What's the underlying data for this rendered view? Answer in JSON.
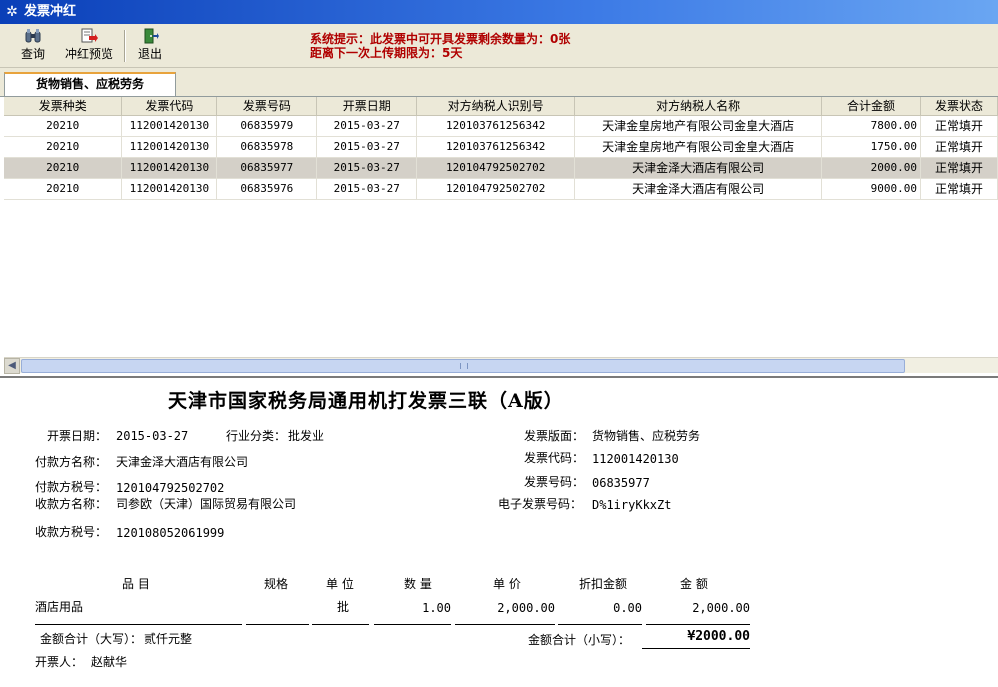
{
  "window": {
    "title": "发票冲红"
  },
  "toolbar": {
    "buttons": [
      {
        "label": "查询",
        "icon": "binoculars-icon"
      },
      {
        "label": "冲红预览",
        "icon": "red-flush-preview-icon"
      },
      {
        "label": "退出",
        "icon": "exit-door-icon"
      }
    ],
    "system_message_line1": "系统提示：此发票中可开具发票剩余数量为：0张",
    "system_message_line2": "距离下一次上传期限为：5天"
  },
  "tabs": [
    {
      "label": "货物销售、应税劳务",
      "active": true
    }
  ],
  "grid": {
    "columns": [
      "发票种类",
      "发票代码",
      "发票号码",
      "开票日期",
      "对方纳税人识别号",
      "对方纳税人名称",
      "合计金额",
      "发票状态"
    ],
    "rows": [
      [
        "20210",
        "112001420130",
        "06835979",
        "2015-03-27",
        "120103761256342",
        "天津金皇房地产有限公司金皇大酒店",
        "7800.00",
        "正常填开"
      ],
      [
        "20210",
        "112001420130",
        "06835978",
        "2015-03-27",
        "120103761256342",
        "天津金皇房地产有限公司金皇大酒店",
        "1750.00",
        "正常填开"
      ],
      [
        "20210",
        "112001420130",
        "06835977",
        "2015-03-27",
        "120104792502702",
        "天津金泽大酒店有限公司",
        "2000.00",
        "正常填开"
      ],
      [
        "20210",
        "112001420130",
        "06835976",
        "2015-03-27",
        "120104792502702",
        "天津金泽大酒店有限公司",
        "9000.00",
        "正常填开"
      ]
    ],
    "selected_row": 2,
    "scrollbar_grip": "|||"
  },
  "invoice": {
    "title": "天津市国家税务局通用机打发票三联（A版）",
    "issue_date_label": "开票日期：",
    "issue_date": "2015-03-27",
    "industry_label": "行业分类：",
    "industry": "批发业",
    "payer_name_label": "付款方名称：",
    "payer_name": "天津金泽大酒店有限公司",
    "payer_tax_label": "付款方税号：",
    "payer_tax": "120104792502702",
    "payee_name_label": "收款方名称：",
    "payee_name": "司参欧（天津）国际贸易有限公司",
    "payee_tax_label": "收款方税号：",
    "payee_tax": "120108052061999",
    "layout_label": "发票版面：",
    "layout": "货物销售、应税劳务",
    "code_label": "发票代码：",
    "code": "112001420130",
    "number_label": "发票号码：",
    "number": "06835977",
    "e_number_label": "电子发票号码：",
    "e_number": "D%1iryKkxZt",
    "items_header": [
      "品 目",
      "规格",
      "单 位",
      "数 量",
      "单 价",
      "折扣金额",
      "金 额"
    ],
    "items": [
      {
        "name": "酒店用品",
        "spec": "",
        "unit": "批",
        "qty": "1.00",
        "price": "2,000.00",
        "discount": "0.00",
        "amount": "2,000.00"
      }
    ],
    "total_upper_label": "金额合计（大写）：",
    "total_upper": "贰仟元整",
    "total_lower_label": "金额合计（小写）：",
    "total_lower": "¥2000.00",
    "issuer_label": "开票人：",
    "issuer": "赵献华"
  },
  "colors": {
    "titlebar": "#0a3fb8",
    "system_message": "#b00000",
    "toolbar_bg": "#ece9d8",
    "selected_row": "#d4d0c8"
  }
}
